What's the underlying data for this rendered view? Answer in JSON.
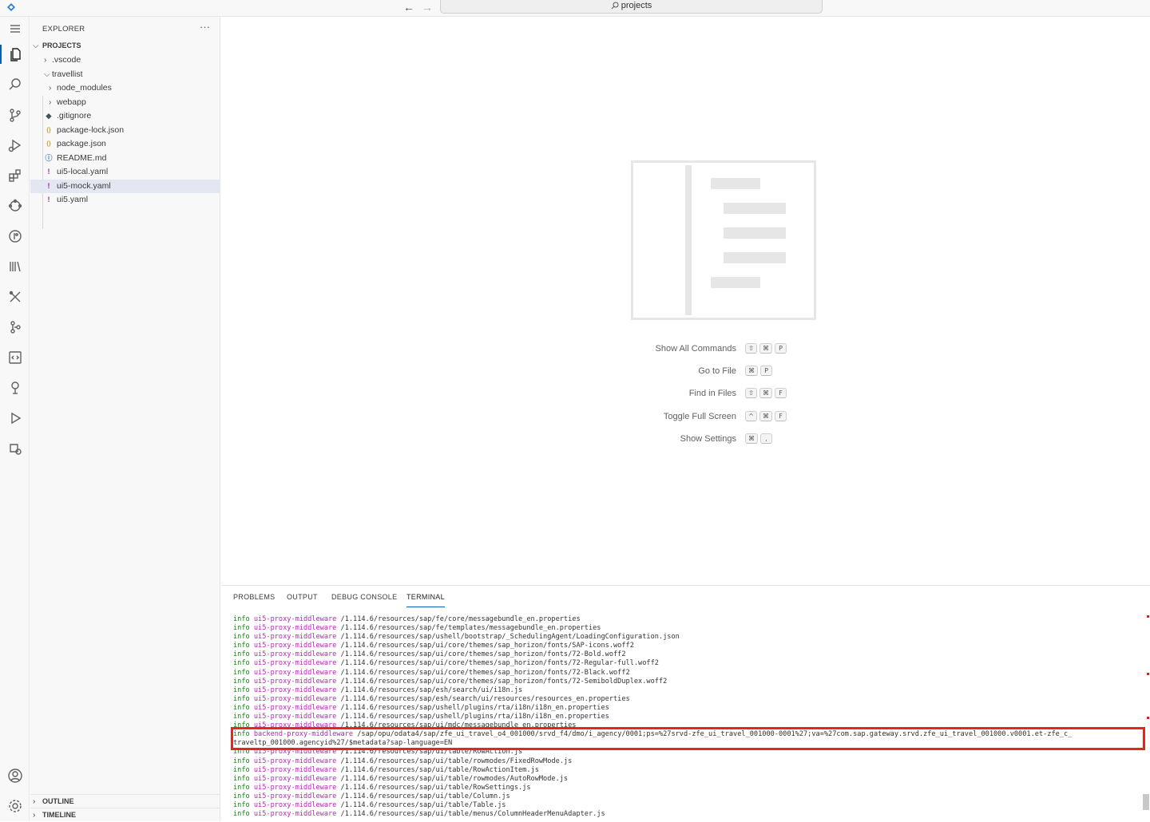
{
  "titlebar": {
    "search_text": "projects",
    "back_icon": "arrow-left-icon",
    "forward_icon": "arrow-right-icon"
  },
  "activity_bar": {
    "items": [
      "menu-icon",
      "explorer-icon",
      "search-icon",
      "source-control-icon",
      "run-debug-icon",
      "extensions-icon",
      "cloud-icon",
      "git-graph-icon",
      "library-icon",
      "tools-icon",
      "branch-icon",
      "code-page-icon",
      "pin-icon",
      "play-icon",
      "settings-debug-icon"
    ],
    "bottom": [
      "account-icon",
      "manage-gear-icon"
    ]
  },
  "sidebar": {
    "title": "EXPLORER",
    "more": "···",
    "projects_header": "PROJECTS",
    "tree": [
      {
        "label": ".vscode",
        "type": "folder",
        "expanded": false,
        "depth": 1
      },
      {
        "label": "travellist",
        "type": "folder",
        "expanded": true,
        "depth": 1
      },
      {
        "label": "node_modules",
        "type": "folder",
        "expanded": false,
        "depth": 2
      },
      {
        "label": "webapp",
        "type": "folder",
        "expanded": false,
        "depth": 2
      },
      {
        "label": ".gitignore",
        "type": "git",
        "depth": 2
      },
      {
        "label": "package-lock.json",
        "type": "json",
        "depth": 2
      },
      {
        "label": "package.json",
        "type": "json",
        "depth": 2
      },
      {
        "label": "README.md",
        "type": "info",
        "depth": 2
      },
      {
        "label": "ui5-local.yaml",
        "type": "yaml",
        "depth": 2
      },
      {
        "label": "ui5-mock.yaml",
        "type": "yaml",
        "depth": 2,
        "selected": true
      },
      {
        "label": "ui5.yaml",
        "type": "yaml",
        "depth": 2
      }
    ],
    "outline_header": "OUTLINE",
    "timeline_header": "TIMELINE"
  },
  "editor": {
    "shortcuts": [
      {
        "label": "Show All Commands",
        "keys": [
          "⇧",
          "⌘",
          "P"
        ]
      },
      {
        "label": "Go to File",
        "keys": [
          "⌘",
          "P"
        ]
      },
      {
        "label": "Find in Files",
        "keys": [
          "⇧",
          "⌘",
          "F"
        ]
      },
      {
        "label": "Toggle Full Screen",
        "keys": [
          "^",
          "⌘",
          "F"
        ]
      },
      {
        "label": "Show Settings",
        "keys": [
          "⌘",
          ","
        ]
      }
    ]
  },
  "panel": {
    "tabs": [
      "PROBLEMS",
      "OUTPUT",
      "DEBUG CONSOLE",
      "TERMINAL"
    ],
    "active_tab": "TERMINAL",
    "terminal_lines": [
      {
        "level": "info",
        "source": "ui5-proxy-middleware",
        "text": "/1.114.6/resources/sap/fe/core/messagebundle_en.properties"
      },
      {
        "level": "info",
        "source": "ui5-proxy-middleware",
        "text": "/1.114.6/resources/sap/fe/templates/messagebundle_en.properties"
      },
      {
        "level": "info",
        "source": "ui5-proxy-middleware",
        "text": "/1.114.6/resources/sap/ushell/bootstrap/_SchedulingAgent/LoadingConfiguration.json"
      },
      {
        "level": "info",
        "source": "ui5-proxy-middleware",
        "text": "/1.114.6/resources/sap/ui/core/themes/sap_horizon/fonts/SAP-icons.woff2"
      },
      {
        "level": "info",
        "source": "ui5-proxy-middleware",
        "text": "/1.114.6/resources/sap/ui/core/themes/sap_horizon/fonts/72-Bold.woff2"
      },
      {
        "level": "info",
        "source": "ui5-proxy-middleware",
        "text": "/1.114.6/resources/sap/ui/core/themes/sap_horizon/fonts/72-Regular-full.woff2"
      },
      {
        "level": "info",
        "source": "ui5-proxy-middleware",
        "text": "/1.114.6/resources/sap/ui/core/themes/sap_horizon/fonts/72-Black.woff2"
      },
      {
        "level": "info",
        "source": "ui5-proxy-middleware",
        "text": "/1.114.6/resources/sap/ui/core/themes/sap_horizon/fonts/72-SemiboldDuplex.woff2"
      },
      {
        "level": "info",
        "source": "ui5-proxy-middleware",
        "text": "/1.114.6/resources/sap/esh/search/ui/i18n.js"
      },
      {
        "level": "info",
        "source": "ui5-proxy-middleware",
        "text": "/1.114.6/resources/sap/esh/search/ui/resources/resources_en.properties"
      },
      {
        "level": "info",
        "source": "ui5-proxy-middleware",
        "text": "/1.114.6/resources/sap/ushell/plugins/rta/i18n/i18n_en.properties"
      },
      {
        "level": "info",
        "source": "ui5-proxy-middleware",
        "text": "/1.114.6/resources/sap/ushell/plugins/rta/i18n/i18n_en.properties"
      },
      {
        "level": "info",
        "source": "ui5-proxy-middleware",
        "text": "/1.114.6/resources/sap/ui/mdc/messagebundle_en.properties"
      },
      {
        "level": "info",
        "source": "backend-proxy-middleware",
        "text": "/sap/opu/odata4/sap/zfe_ui_travel_o4_001000/srvd_f4/dmo/i_agency/0001;ps=%27srvd-zfe_ui_travel_001000-0001%27;va=%27com.sap.gateway.srvd.zfe_ui_travel_001000.v0001.et-zfe_c_"
      },
      {
        "level": "",
        "source": "",
        "text": "traveltp_001000.agencyid%27/$metadata?sap-language=EN"
      },
      {
        "level": "info",
        "source": "ui5-proxy-middleware",
        "text": "/1.114.6/resources/sap/ui/table/RowAction.js"
      },
      {
        "level": "info",
        "source": "ui5-proxy-middleware",
        "text": "/1.114.6/resources/sap/ui/table/rowmodes/FixedRowMode.js"
      },
      {
        "level": "info",
        "source": "ui5-proxy-middleware",
        "text": "/1.114.6/resources/sap/ui/table/RowActionItem.js"
      },
      {
        "level": "info",
        "source": "ui5-proxy-middleware",
        "text": "/1.114.6/resources/sap/ui/table/rowmodes/AutoRowMode.js"
      },
      {
        "level": "info",
        "source": "ui5-proxy-middleware",
        "text": "/1.114.6/resources/sap/ui/table/RowSettings.js"
      },
      {
        "level": "info",
        "source": "ui5-proxy-middleware",
        "text": "/1.114.6/resources/sap/ui/table/Column.js"
      },
      {
        "level": "info",
        "source": "ui5-proxy-middleware",
        "text": "/1.114.6/resources/sap/ui/table/Table.js"
      },
      {
        "level": "info",
        "source": "ui5-proxy-middleware",
        "text": "/1.114.6/resources/sap/ui/table/menus/ColumnHeaderMenuAdapter.js"
      }
    ]
  },
  "colors": {
    "accent": "#005fb8",
    "info": "#0f8a0f",
    "middleware": "#bf21bf",
    "highlight": "#e0281e"
  }
}
